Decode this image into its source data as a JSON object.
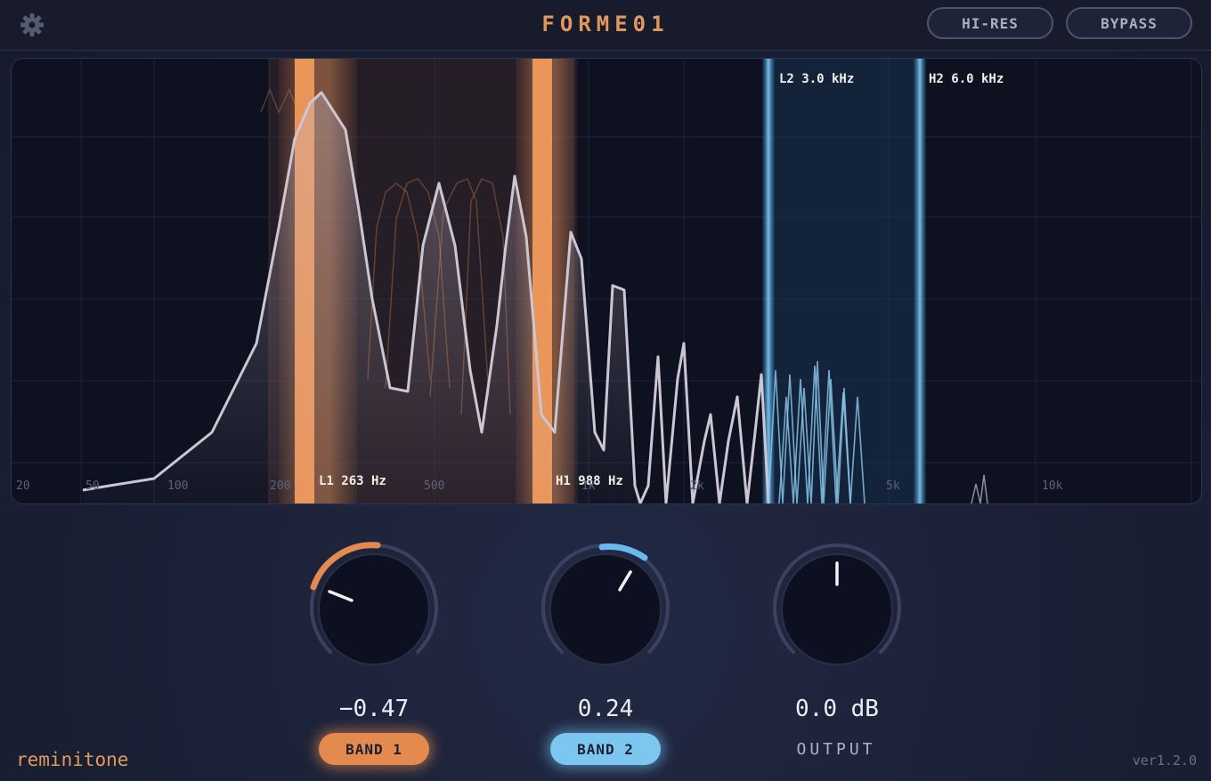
{
  "app": {
    "title": "FORME01",
    "brand": "reminitone",
    "version": "ver1.2.0"
  },
  "header": {
    "settings_icon": "gear-icon",
    "hires_label": "HI-RES",
    "bypass_label": "BYPASS"
  },
  "spectrum": {
    "freq_ticks": [
      "20",
      "50",
      "100",
      "200",
      "500",
      "1k",
      "2k",
      "5k",
      "10k"
    ],
    "band1": {
      "low_label": "L1 263 Hz",
      "high_label": "H1 988 Hz",
      "low_hz": 263,
      "high_hz": 988,
      "color": "#e58a4e"
    },
    "band2": {
      "low_label": "L2 3.0 kHz",
      "high_label": "H2 6.0 kHz",
      "low_hz": 3000,
      "high_hz": 6000,
      "color": "#5cb4ec"
    }
  },
  "knobs": {
    "band1": {
      "value": "−0.47",
      "button_label": "BAND 1",
      "color": "#e58a4e"
    },
    "band2": {
      "value": "0.24",
      "button_label": "BAND 2",
      "color": "#6ab8ee"
    },
    "output": {
      "value": "0.0 dB",
      "label": "OUTPUT"
    }
  }
}
